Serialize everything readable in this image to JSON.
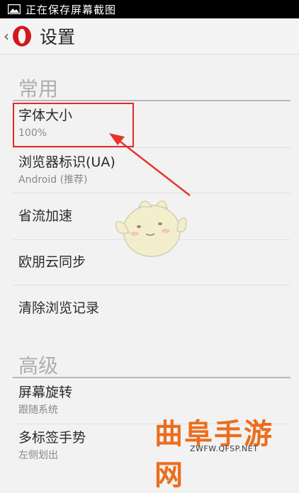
{
  "status_bar": {
    "text": "正在保存屏幕截图",
    "icon": "image-icon"
  },
  "action_bar": {
    "back": "‹",
    "logo_letter": "O",
    "title": "设置"
  },
  "sections": {
    "common": "常用",
    "advanced": "高级"
  },
  "rows": {
    "font_size": {
      "title": "字体大小",
      "value": "100%"
    },
    "user_agent": {
      "title": "浏览器标识(UA)",
      "value": "Android (推荐)"
    },
    "data_saver": {
      "title": "省流加速"
    },
    "sync": {
      "title": "欧朋云同步"
    },
    "clear_history": {
      "title": "清除浏览记录"
    },
    "rotation": {
      "title": "屏幕旋转",
      "value": "跟随系统"
    },
    "tab_gesture": {
      "title": "多标签手势",
      "value": "左侧划出"
    }
  },
  "watermark": {
    "title": "曲阜手游网",
    "url": "ZWFW.QFSP.NET"
  },
  "colors": {
    "highlight": "#e02a2a",
    "opera_red": "#d0191e",
    "watermark": "#eb6d1d"
  }
}
